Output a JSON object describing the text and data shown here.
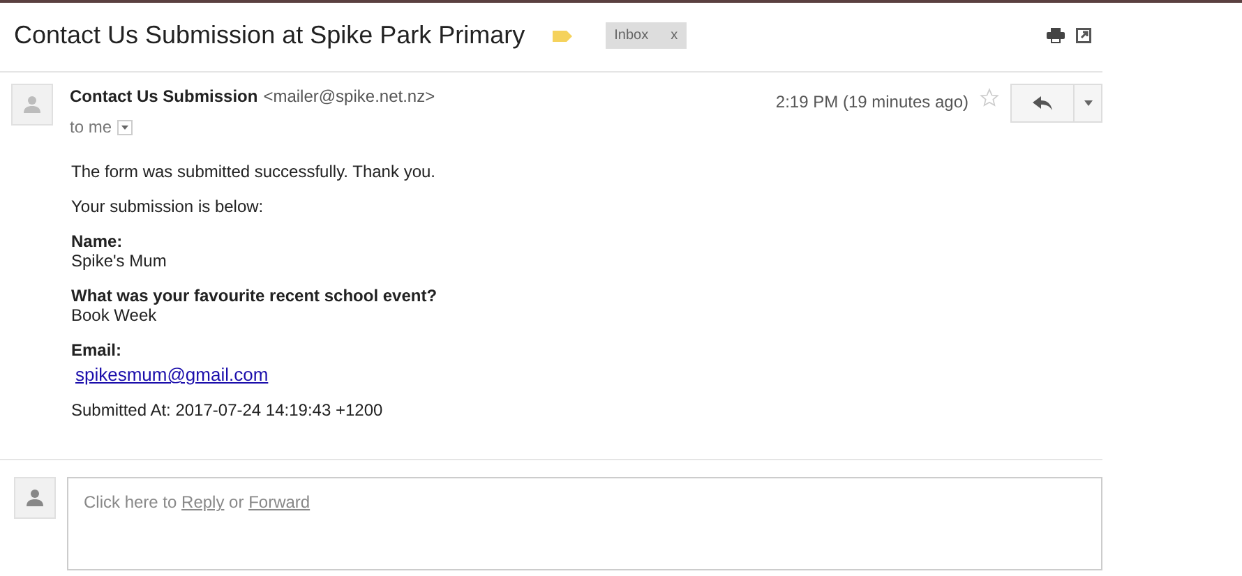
{
  "subject": "Contact Us Submission at Spike Park Primary",
  "labels": [
    {
      "text": "Inbox",
      "remove": "x"
    }
  ],
  "message": {
    "sender_name": "Contact Us Submission",
    "sender_email": "<mailer@spike.net.nz>",
    "recipient": "to me",
    "time": "2:19 PM (19 minutes ago)",
    "starred": false
  },
  "body": [
    {
      "kind": "text",
      "text": "The form was submitted successfully. Thank you."
    },
    {
      "kind": "text",
      "text": "Your submission is below:"
    },
    {
      "kind": "field",
      "label": "Name:",
      "value": "Spike's Mum"
    },
    {
      "kind": "field",
      "label": "What was your favourite recent school event?",
      "value": "Book Week"
    },
    {
      "kind": "link_field",
      "label": "Email:",
      "value": "spikesmum@gmail.com"
    },
    {
      "kind": "text",
      "text": "Submitted At: 2017-07-24 14:19:43 +1200"
    }
  ],
  "reply_box": {
    "before": "Click here to ",
    "reply": "Reply",
    "middle": " or ",
    "forward": "Forward"
  }
}
